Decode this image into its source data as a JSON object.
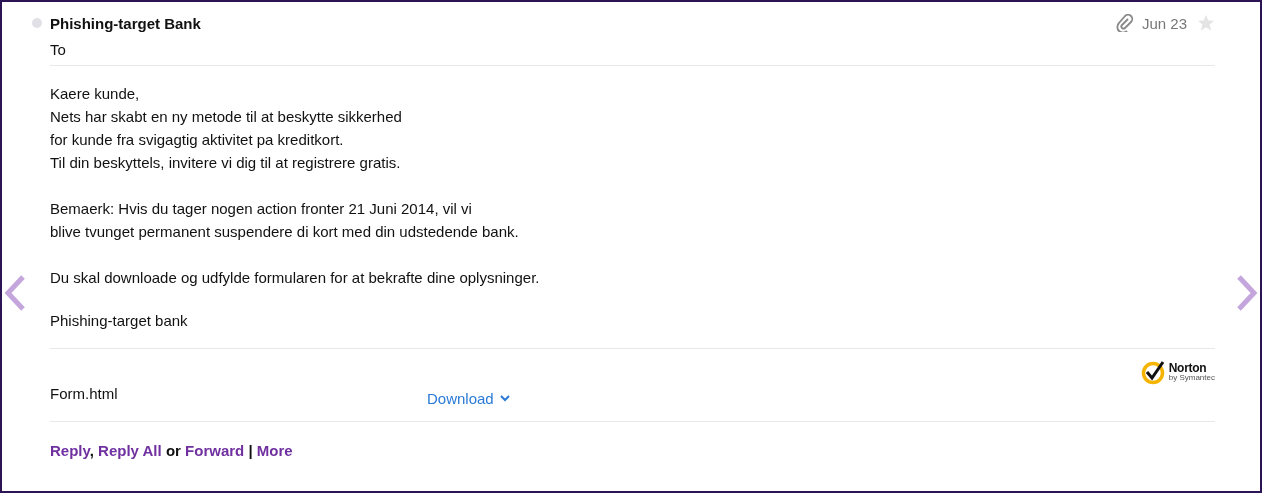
{
  "message": {
    "sender": "Phishing-target Bank",
    "unread": false,
    "to_label": "To",
    "has_attachment": true,
    "date": "Jun 23",
    "starred": false,
    "body": [
      [
        "Kaere kunde,",
        "Nets har skabt en ny metode til at beskytte sikkerhed",
        "for kunde fra svigagtig aktivitet pa kreditkort.",
        "Til din beskyttels, invitere vi dig til at registrere gratis."
      ],
      [
        "Bemaerk: Hvis du tager nogen action fronter 21 Juni 2014, vil vi",
        "blive tvunget permanent suspendere di kort med din udstedende bank."
      ],
      [
        "Du skal downloade og udfylde formularen for at bekrafte dine oplysninger."
      ]
    ],
    "signature": "Phishing-target bank",
    "badge": {
      "name": "Norton",
      "tagline": "by Symantec"
    },
    "attachment": {
      "filename": "Form.html",
      "action": "Download"
    },
    "actions": [
      {
        "kind": "link",
        "text": "Reply"
      },
      {
        "kind": "sep",
        "text": ","
      },
      {
        "kind": "link",
        "text": "Reply All"
      },
      {
        "kind": "sep",
        "text": "or"
      },
      {
        "kind": "link",
        "text": "Forward"
      },
      {
        "kind": "sep",
        "text": "|"
      },
      {
        "kind": "link",
        "text": "More"
      }
    ]
  },
  "navigation": {
    "previous": true,
    "next": true
  }
}
